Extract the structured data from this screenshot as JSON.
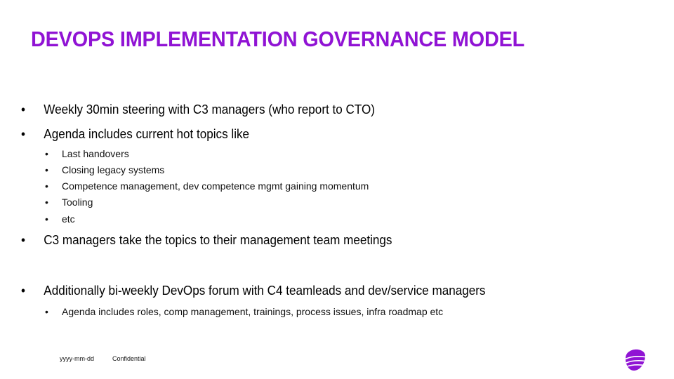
{
  "slide": {
    "title": "DEVOPS IMPLEMENTATION GOVERNANCE MODEL",
    "accent_color": "#9013d4",
    "bullet_char": "•",
    "bullets": [
      {
        "text": "Weekly 30min steering with C3 managers (who report to CTO)"
      },
      {
        "text": "Agenda includes current hot topics like",
        "sub": [
          "Last handovers",
          "Closing legacy systems",
          "Competence management, dev competence mgmt gaining momentum",
          "Tooling",
          "etc"
        ]
      },
      {
        "text": "C3 managers take the topics to their management team meetings"
      },
      {
        "text": "Additionally bi-weekly DevOps forum with C4 teamleads and dev/service managers",
        "sub": [
          "Agenda includes roles, comp management, trainings, process issues, infra roadmap etc"
        ]
      }
    ]
  },
  "footer": {
    "date": "yyyy-mm-dd",
    "confidential": "Confidential",
    "logo_icon": "telia-pebble-logo"
  }
}
